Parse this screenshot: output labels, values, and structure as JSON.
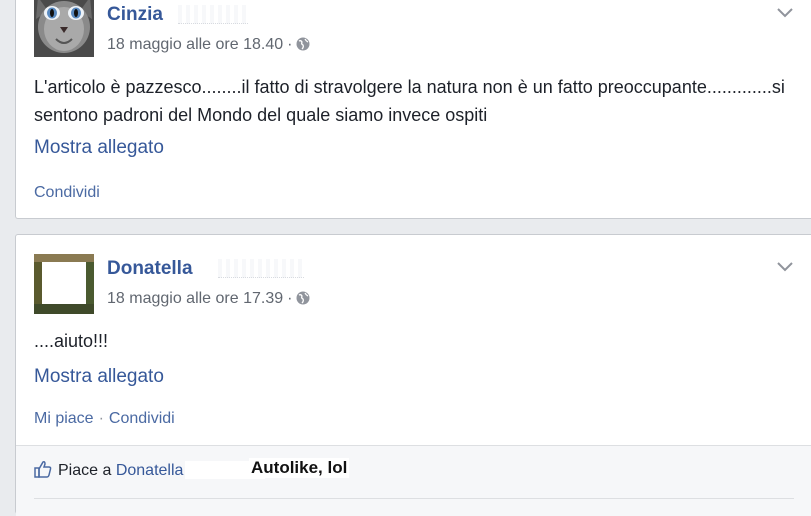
{
  "posts": [
    {
      "author": "Cinzia",
      "timestamp": "18 maggio alle ore 18.40",
      "separator": "·",
      "privacy_icon": "globe-icon",
      "text": "L'articolo è pazzesco........il fatto di stravolgere la natura non è un fatto preoccupante.............si sentono padroni del Mondo del quale siamo invece ospiti",
      "attachment_label": "Mostra allegato",
      "actions": {
        "share": "Condividi"
      }
    },
    {
      "author": "Donatella",
      "timestamp": "18 maggio alle ore 17.39",
      "separator": "·",
      "privacy_icon": "globe-icon",
      "text": "....aiuto!!!",
      "attachment_label": "Mostra allegato",
      "actions": {
        "like": "Mi piace",
        "separator": "·",
        "share": "Condividi"
      },
      "likes": {
        "icon": "thumbs-up-icon",
        "prefix": "Piace a",
        "liker": "Donatella"
      },
      "caption": "Autolike, lol"
    }
  ],
  "colors": {
    "link": "#365899",
    "text": "#1d2129",
    "meta": "#616770",
    "background": "#e9ebee",
    "card": "#ffffff",
    "likes_bar": "#f6f7f9"
  }
}
